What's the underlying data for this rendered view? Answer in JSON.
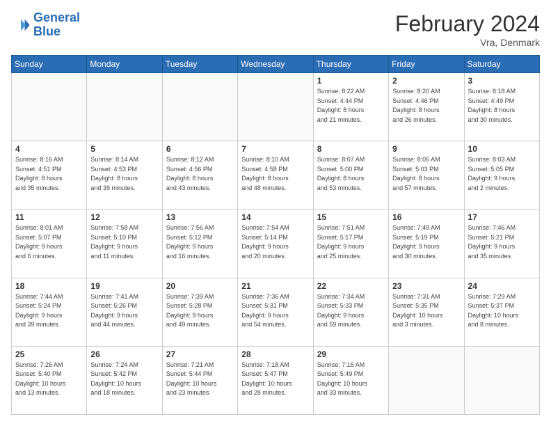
{
  "header": {
    "logo_line1": "General",
    "logo_line2": "Blue",
    "title": "February 2024",
    "subtitle": "Vra, Denmark"
  },
  "weekdays": [
    "Sunday",
    "Monday",
    "Tuesday",
    "Wednesday",
    "Thursday",
    "Friday",
    "Saturday"
  ],
  "weeks": [
    [
      {
        "day": "",
        "info": ""
      },
      {
        "day": "",
        "info": ""
      },
      {
        "day": "",
        "info": ""
      },
      {
        "day": "",
        "info": ""
      },
      {
        "day": "1",
        "info": "Sunrise: 8:22 AM\nSunset: 4:44 PM\nDaylight: 8 hours\nand 21 minutes."
      },
      {
        "day": "2",
        "info": "Sunrise: 8:20 AM\nSunset: 4:46 PM\nDaylight: 8 hours\nand 26 minutes."
      },
      {
        "day": "3",
        "info": "Sunrise: 8:18 AM\nSunset: 4:49 PM\nDaylight: 8 hours\nand 30 minutes."
      }
    ],
    [
      {
        "day": "4",
        "info": "Sunrise: 8:16 AM\nSunset: 4:51 PM\nDaylight: 8 hours\nand 35 minutes."
      },
      {
        "day": "5",
        "info": "Sunrise: 8:14 AM\nSunset: 4:53 PM\nDaylight: 8 hours\nand 39 minutes."
      },
      {
        "day": "6",
        "info": "Sunrise: 8:12 AM\nSunset: 4:56 PM\nDaylight: 8 hours\nand 43 minutes."
      },
      {
        "day": "7",
        "info": "Sunrise: 8:10 AM\nSunset: 4:58 PM\nDaylight: 8 hours\nand 48 minutes."
      },
      {
        "day": "8",
        "info": "Sunrise: 8:07 AM\nSunset: 5:00 PM\nDaylight: 8 hours\nand 53 minutes."
      },
      {
        "day": "9",
        "info": "Sunrise: 8:05 AM\nSunset: 5:03 PM\nDaylight: 8 hours\nand 57 minutes."
      },
      {
        "day": "10",
        "info": "Sunrise: 8:03 AM\nSunset: 5:05 PM\nDaylight: 9 hours\nand 2 minutes."
      }
    ],
    [
      {
        "day": "11",
        "info": "Sunrise: 8:01 AM\nSunset: 5:07 PM\nDaylight: 9 hours\nand 6 minutes."
      },
      {
        "day": "12",
        "info": "Sunrise: 7:58 AM\nSunset: 5:10 PM\nDaylight: 9 hours\nand 11 minutes."
      },
      {
        "day": "13",
        "info": "Sunrise: 7:56 AM\nSunset: 5:12 PM\nDaylight: 9 hours\nand 16 minutes."
      },
      {
        "day": "14",
        "info": "Sunrise: 7:54 AM\nSunset: 5:14 PM\nDaylight: 9 hours\nand 20 minutes."
      },
      {
        "day": "15",
        "info": "Sunrise: 7:51 AM\nSunset: 5:17 PM\nDaylight: 9 hours\nand 25 minutes."
      },
      {
        "day": "16",
        "info": "Sunrise: 7:49 AM\nSunset: 5:19 PM\nDaylight: 9 hours\nand 30 minutes."
      },
      {
        "day": "17",
        "info": "Sunrise: 7:46 AM\nSunset: 5:21 PM\nDaylight: 9 hours\nand 35 minutes."
      }
    ],
    [
      {
        "day": "18",
        "info": "Sunrise: 7:44 AM\nSunset: 5:24 PM\nDaylight: 9 hours\nand 39 minutes."
      },
      {
        "day": "19",
        "info": "Sunrise: 7:41 AM\nSunset: 5:26 PM\nDaylight: 9 hours\nand 44 minutes."
      },
      {
        "day": "20",
        "info": "Sunrise: 7:39 AM\nSunset: 5:28 PM\nDaylight: 9 hours\nand 49 minutes."
      },
      {
        "day": "21",
        "info": "Sunrise: 7:36 AM\nSunset: 5:31 PM\nDaylight: 9 hours\nand 54 minutes."
      },
      {
        "day": "22",
        "info": "Sunrise: 7:34 AM\nSunset: 5:33 PM\nDaylight: 9 hours\nand 59 minutes."
      },
      {
        "day": "23",
        "info": "Sunrise: 7:31 AM\nSunset: 5:35 PM\nDaylight: 10 hours\nand 3 minutes."
      },
      {
        "day": "24",
        "info": "Sunrise: 7:29 AM\nSunset: 5:37 PM\nDaylight: 10 hours\nand 8 minutes."
      }
    ],
    [
      {
        "day": "25",
        "info": "Sunrise: 7:26 AM\nSunset: 5:40 PM\nDaylight: 10 hours\nand 13 minutes."
      },
      {
        "day": "26",
        "info": "Sunrise: 7:24 AM\nSunset: 5:42 PM\nDaylight: 10 hours\nand 18 minutes."
      },
      {
        "day": "27",
        "info": "Sunrise: 7:21 AM\nSunset: 5:44 PM\nDaylight: 10 hours\nand 23 minutes."
      },
      {
        "day": "28",
        "info": "Sunrise: 7:18 AM\nSunset: 5:47 PM\nDaylight: 10 hours\nand 28 minutes."
      },
      {
        "day": "29",
        "info": "Sunrise: 7:16 AM\nSunset: 5:49 PM\nDaylight: 10 hours\nand 33 minutes."
      },
      {
        "day": "",
        "info": ""
      },
      {
        "day": "",
        "info": ""
      }
    ]
  ]
}
